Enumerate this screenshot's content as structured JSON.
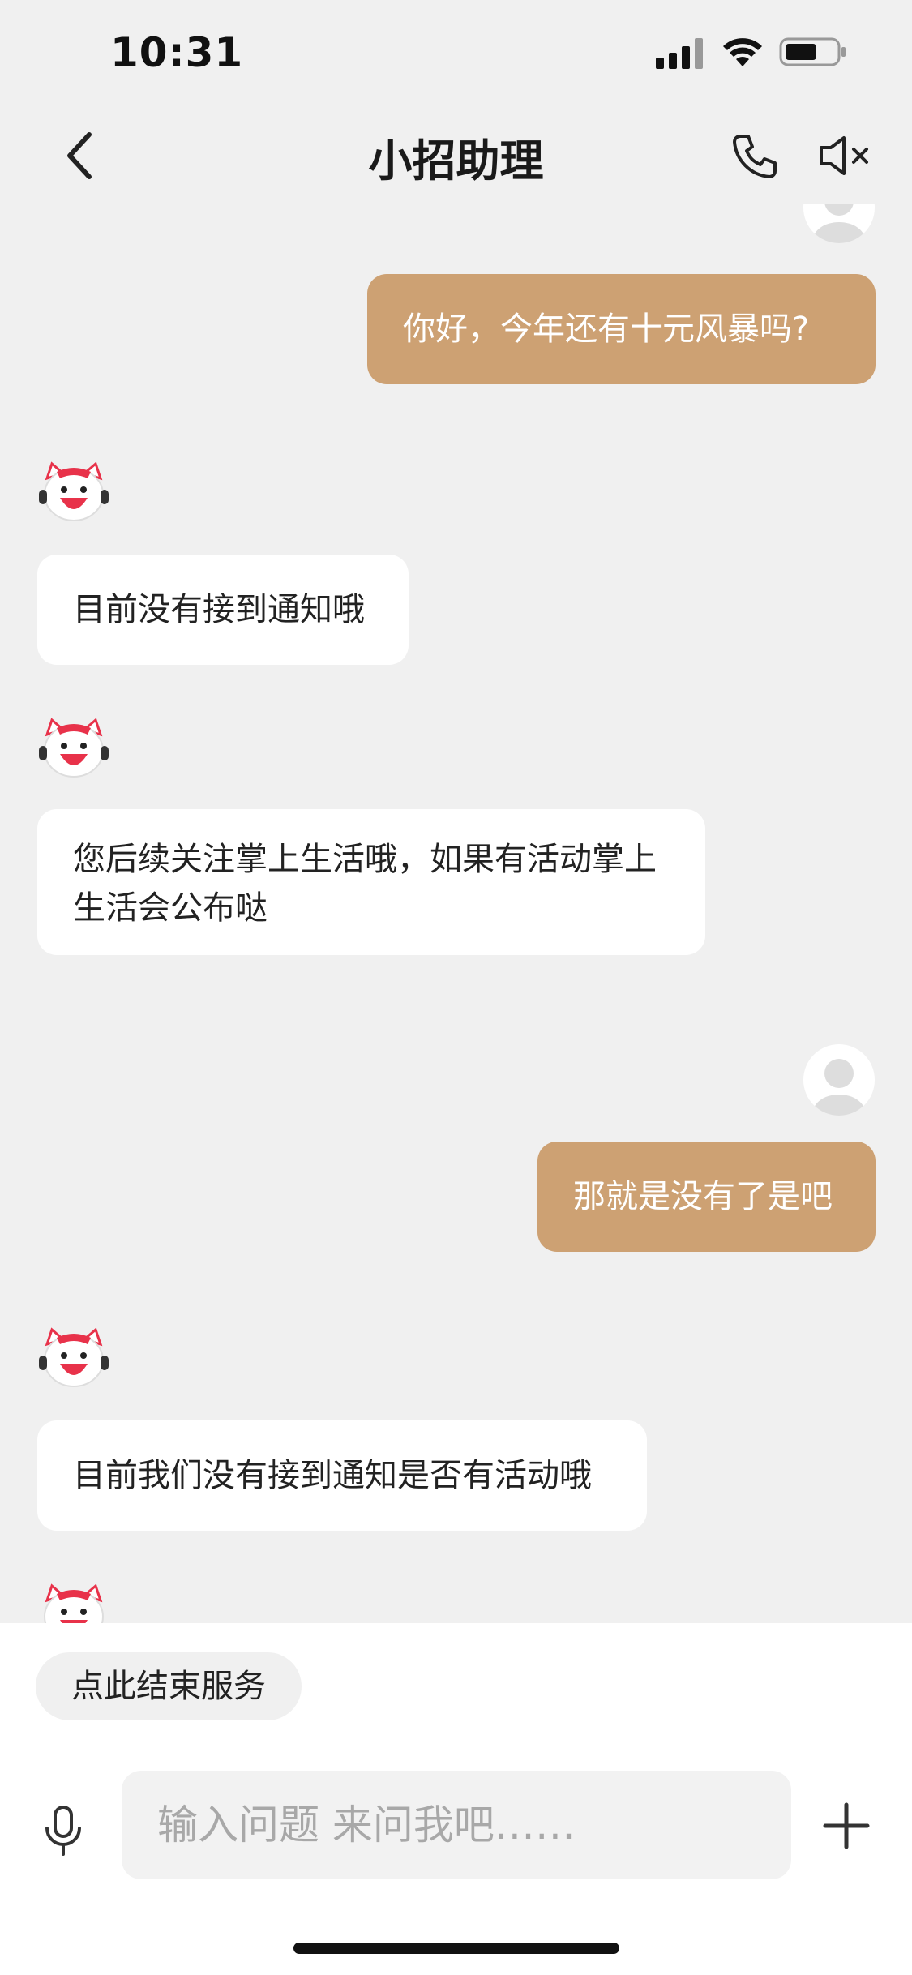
{
  "status_bar": {
    "time": "10:31",
    "icons": [
      "signal-icon",
      "wifi-icon",
      "battery-icon"
    ]
  },
  "header": {
    "title": "小招助理",
    "icons": [
      "back-arrow-icon",
      "phone-icon",
      "speaker-mute-icon"
    ]
  },
  "messages": [
    {
      "from": "user",
      "text": "你好，今年还有十元风暴吗?"
    },
    {
      "from": "bot",
      "text": "目前没有接到通知哦"
    },
    {
      "from": "bot",
      "text": "您后续关注掌上生活哦，如果有活动掌上生活会公布哒"
    },
    {
      "from": "user",
      "text": "那就是没有了是吧"
    },
    {
      "from": "bot",
      "text": "目前我们没有接到通知是否有活动哦"
    }
  ],
  "bottom": {
    "end_service_label": "点此结束服务",
    "input_placeholder": "输入问题 来问我吧……",
    "icons": [
      "microphone-icon",
      "plus-icon"
    ]
  },
  "colors": {
    "background": "#f0f0f0",
    "user_bubble": "#cda173",
    "bot_bubble": "#ffffff",
    "bot_avatar_accent": "#e8324a"
  }
}
